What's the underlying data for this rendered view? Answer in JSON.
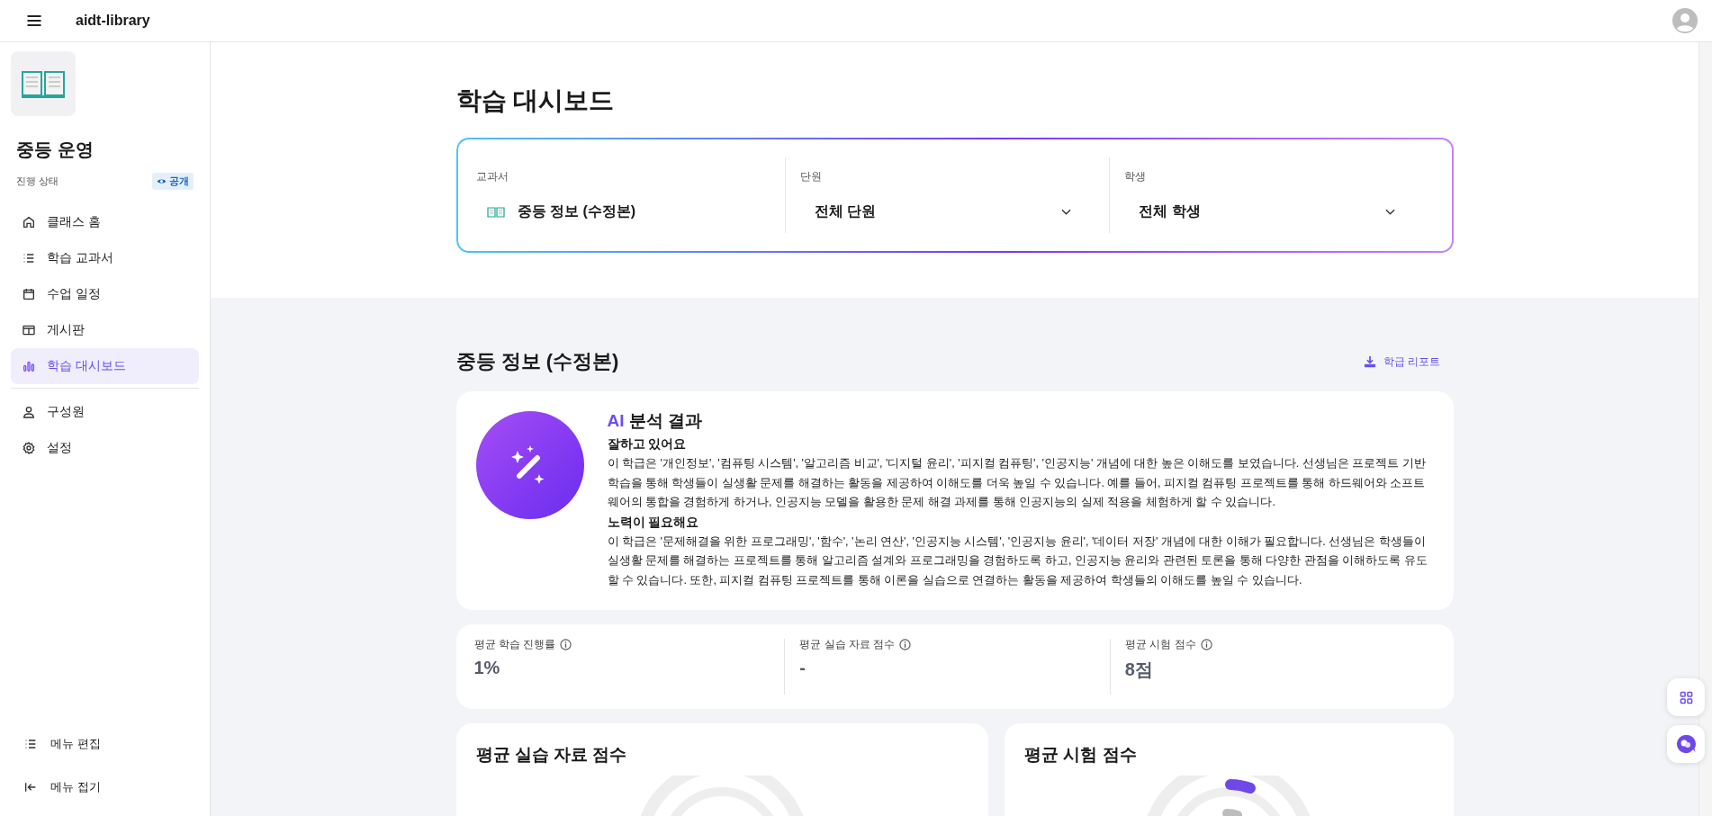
{
  "topbar": {
    "title": "aidt-library"
  },
  "sidebar": {
    "class_name": "중등 운영",
    "status_label": "진행 상태",
    "visibility_badge": "공개",
    "items": [
      {
        "label": "클래스 홈",
        "selected": false
      },
      {
        "label": "학습 교과서",
        "selected": false
      },
      {
        "label": "수업 일정",
        "selected": false
      },
      {
        "label": "게시판",
        "selected": false
      },
      {
        "label": "학습 대시보드",
        "selected": true
      }
    ],
    "items_2": [
      {
        "label": "구성원",
        "selected": false
      },
      {
        "label": "설정",
        "selected": false
      }
    ],
    "footer": [
      "메뉴 편집",
      "메뉴 접기"
    ]
  },
  "page_title": "학습 대시보드",
  "filters": [
    {
      "label": "교과서",
      "value": "중등 정보 (수정본)",
      "kind": "book"
    },
    {
      "label": "단원",
      "value": "전체 단원",
      "kind": "dropdown"
    },
    {
      "label": "학생",
      "value": "전체 학생",
      "kind": "dropdown"
    }
  ],
  "section": {
    "title": "중등 정보 (수정본)",
    "report_link": "학급 리포트"
  },
  "ai_analysis": {
    "title_accent": "AI",
    "title": "분석 결과",
    "blocks": [
      {
        "heading": "잘하고 있어요",
        "text": "이 학급은 '개인정보', '컴퓨팅 시스템', '알고리즘 비교', '디지털 윤리', '피지컬 컴퓨팅', '인공지능' 개념에 대한 높은 이해도를 보였습니다. 선생님은 프로젝트 기반 학습을 통해 학생들이 실생활 문제를 해결하는 활동을 제공하여 이해도를 더욱 높일 수 있습니다. 예를 들어, 피지컬 컴퓨팅 프로젝트를 통해 하드웨어와 소프트웨어의 통합을 경험하게 하거나, 인공지능 모델을 활용한 문제 해결 과제를 통해 인공지능의 실제 적용을 체험하게 할 수 있습니다."
      },
      {
        "heading": "노력이 필요해요",
        "text": "이 학급은 '문제해결을 위한 프로그래밍', '함수', '논리 연산', '인공지능 시스템', '인공지능 윤리', '데이터 저장' 개념에 대한 이해가 필요합니다. 선생님은 학생들이 실생활 문제를 해결하는 프로젝트를 통해 알고리즘 설계와 프로그래밍을 경험하도록 하고, 인공지능 윤리와 관련된 토론을 통해 다양한 관점을 이해하도록 유도할 수 있습니다. 또한, 피지컬 컴퓨팅 프로젝트를 통해 이론을 실습으로 연결하는 활동을 제공하여 학생들의 이해도를 높일 수 있습니다."
      }
    ]
  },
  "stats": [
    {
      "label": "평균 학습 진행률",
      "value": "1%"
    },
    {
      "label": "평균 실습 자료 점수",
      "value": "-"
    },
    {
      "label": "평균 시험 점수",
      "value": "8점"
    }
  ],
  "charts": [
    {
      "title": "평균 실습 자료 점수"
    },
    {
      "title": "평균 시험 점수"
    }
  ]
}
